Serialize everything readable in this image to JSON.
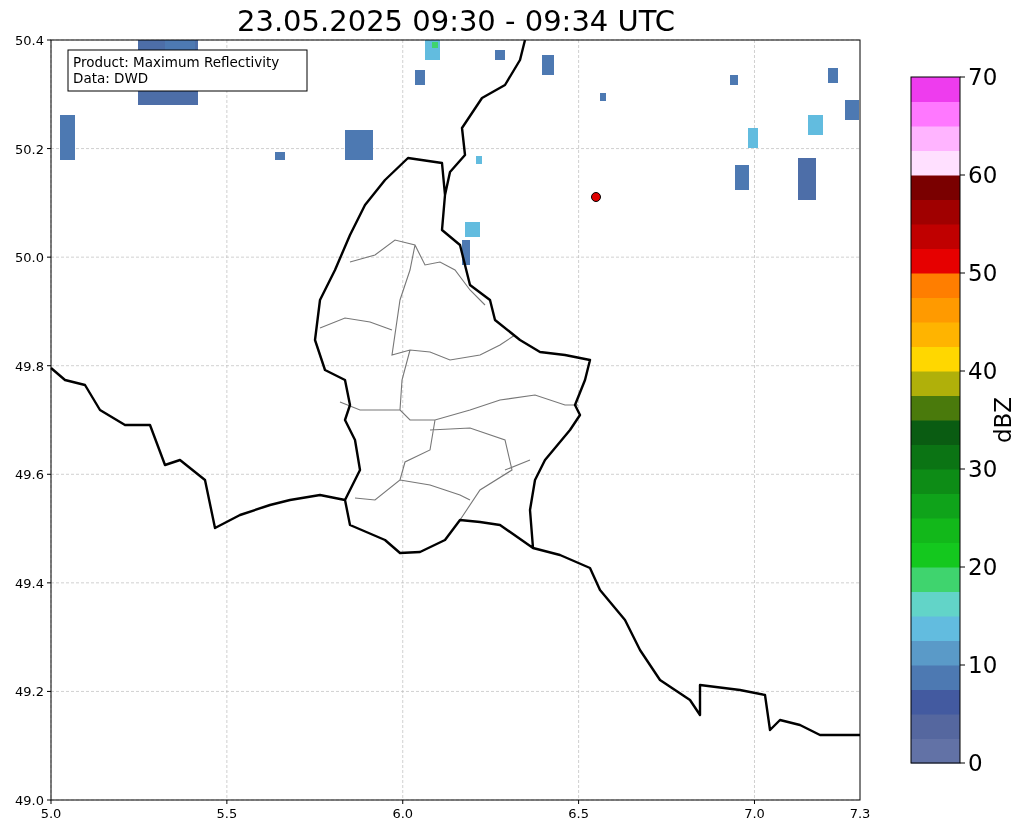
{
  "title": "23.05.2025 09:30 - 09:34 UTC",
  "annotation": [
    "Product: Maximum Reflectivity",
    "Data: DWD"
  ],
  "x_ticks": [
    "5.0",
    "5.5",
    "6.0",
    "6.5",
    "7.0"
  ],
  "x_end_label": "7.3",
  "y_ticks": [
    "50.4",
    "50.2",
    "50.0",
    "49.8",
    "49.6",
    "49.4",
    "49.2",
    "49.0"
  ],
  "colorbar": {
    "label": "dBZ",
    "ticks": [
      "70",
      "60",
      "50",
      "40",
      "30",
      "20",
      "10",
      "0"
    ],
    "bands": [
      {
        "color": "#6272a6"
      },
      {
        "color": "#55679f"
      },
      {
        "color": "#435aa0"
      },
      {
        "color": "#4d79b2"
      },
      {
        "color": "#5a9ac8"
      },
      {
        "color": "#62bcdf"
      },
      {
        "color": "#62d4c8"
      },
      {
        "color": "#3fd46e"
      },
      {
        "color": "#14c81e"
      },
      {
        "color": "#12b81a"
      },
      {
        "color": "#0fa31a"
      },
      {
        "color": "#0d8c16"
      },
      {
        "color": "#0b7414"
      },
      {
        "color": "#0a5c12"
      },
      {
        "color": "#4a7a0c"
      },
      {
        "color": "#b0b00a"
      },
      {
        "color": "#ffd700"
      },
      {
        "color": "#ffb400"
      },
      {
        "color": "#ff9a00"
      },
      {
        "color": "#ff7e00"
      },
      {
        "color": "#e60000"
      },
      {
        "color": "#c00000"
      },
      {
        "color": "#a00000"
      },
      {
        "color": "#7a0000"
      },
      {
        "color": "#ffe0ff"
      },
      {
        "color": "#ffb4ff"
      },
      {
        "color": "#ff78ff"
      },
      {
        "color": "#ee3cee"
      }
    ]
  }
}
